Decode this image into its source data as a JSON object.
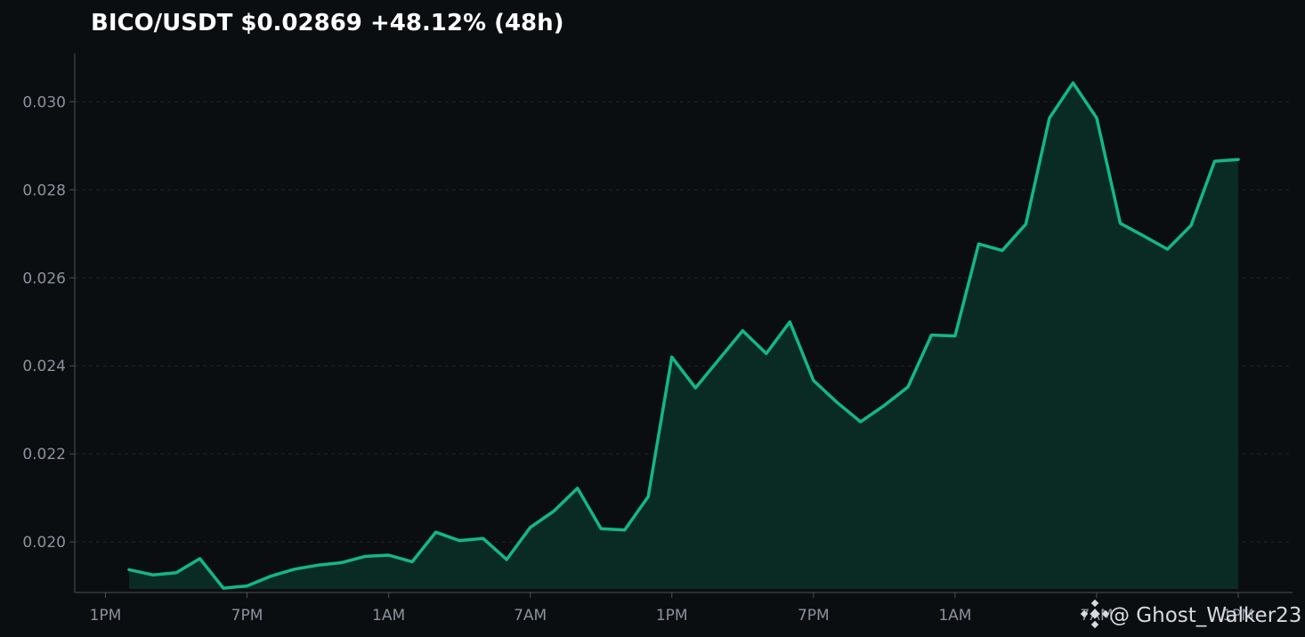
{
  "chart_data": {
    "type": "area",
    "title": "BICO/USDT   $0.02869  +48.12%  (48h)",
    "xlabel": "",
    "ylabel": "",
    "x_tick_labels": [
      "1PM",
      "7PM",
      "1AM",
      "7AM",
      "1PM",
      "7PM",
      "1AM",
      "7AM",
      "1PM"
    ],
    "x_tick_hours": [
      0,
      6,
      12,
      18,
      24,
      30,
      36,
      42,
      48
    ],
    "xlim_hours": [
      -1.3,
      50.3
    ],
    "ylim": [
      0.01885,
      0.0311
    ],
    "y_ticks": [
      0.02,
      0.022,
      0.024,
      0.026,
      0.028,
      0.03
    ],
    "y_tick_labels": [
      "0.020",
      "0.022",
      "0.024",
      "0.026",
      "0.028",
      "0.030"
    ],
    "grid": true,
    "series": [
      {
        "color": "#12b886",
        "fill_color": "#0a2d26",
        "x_hours": [
          1,
          2,
          3,
          4,
          5,
          6,
          7,
          8,
          9,
          10,
          11,
          12,
          13,
          14,
          15,
          16,
          17,
          18,
          19,
          20,
          21,
          22,
          23,
          24,
          25,
          26,
          27,
          28,
          29,
          30,
          31,
          32,
          33,
          34,
          35,
          36,
          37,
          38,
          39,
          40,
          41,
          42,
          43,
          44,
          45,
          46,
          47,
          48
        ],
        "values": [
          0.01937,
          0.01925,
          0.0193,
          0.01962,
          0.01895,
          0.019,
          0.01922,
          0.01938,
          0.01947,
          0.01953,
          0.01967,
          0.0197,
          0.01955,
          0.02022,
          0.02003,
          0.02008,
          0.0196,
          0.02033,
          0.0207,
          0.02122,
          0.0203,
          0.02027,
          0.02103,
          0.0242,
          0.0235,
          0.02415,
          0.0248,
          0.02428,
          0.025,
          0.02367,
          0.02317,
          0.02273,
          0.0231,
          0.02352,
          0.0247,
          0.02468,
          0.02677,
          0.02662,
          0.02722,
          0.02963,
          0.03043,
          0.02963,
          0.02724,
          0.02695,
          0.02665,
          0.02719,
          0.02865,
          0.02869
        ]
      }
    ]
  },
  "watermark": {
    "text": "@ Ghost_Walker23",
    "icon": "binance-logo-icon"
  }
}
